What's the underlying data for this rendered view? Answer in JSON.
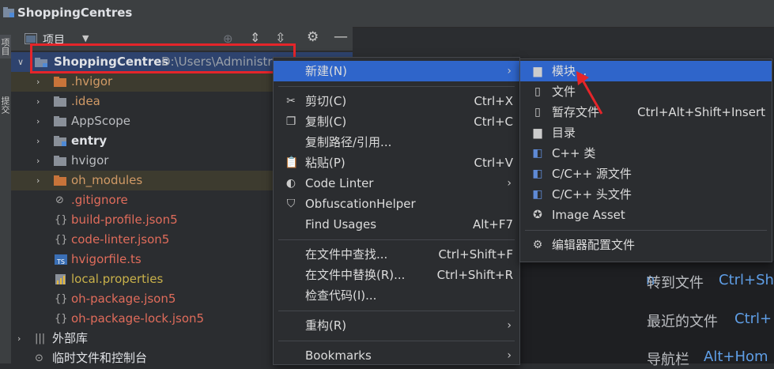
{
  "window": {
    "title": "ShoppingCentres"
  },
  "left_strip": {
    "tab1": "项目",
    "tab2": "提交"
  },
  "project_panel": {
    "view_label": "项目"
  },
  "tree": {
    "root_name": "ShoppingCentres",
    "root_path": "D:\\Users\\Administr",
    "items": [
      {
        "label": ".hvigor",
        "color": "#d19a66"
      },
      {
        "label": ".idea",
        "color": "#d19a66"
      },
      {
        "label": "AppScope",
        "color": "#bbbdc1"
      },
      {
        "label": "entry",
        "color": "#dfe1e5"
      },
      {
        "label": "hvigor",
        "color": "#bbbdc1"
      },
      {
        "label": "oh_modules",
        "color": "#d19a66"
      },
      {
        "label": ".gitignore",
        "color": "#e06c5b"
      },
      {
        "label": "build-profile.json5",
        "color": "#e06c5b"
      },
      {
        "label": "code-linter.json5",
        "color": "#e06c5b"
      },
      {
        "label": "hvigorfile.ts",
        "color": "#e06c5b"
      },
      {
        "label": "local.properties",
        "color": "#c9b14a"
      },
      {
        "label": "oh-package.json5",
        "color": "#e06c5b"
      },
      {
        "label": "oh-package-lock.json5",
        "color": "#e06c5b"
      }
    ],
    "external_libs": "外部库",
    "scratches": "临时文件和控制台"
  },
  "context_menu": {
    "new": "新建(N)",
    "cut": "剪切(C)",
    "cut_sc": "Ctrl+X",
    "copy": "复制(C)",
    "copy_sc": "Ctrl+C",
    "copy_path": "复制路径/引用...",
    "paste": "粘贴(P)",
    "paste_sc": "Ctrl+V",
    "code_linter": "Code Linter",
    "obfuscation": "ObfuscationHelper",
    "find_usages": "Find Usages",
    "find_usages_sc": "Alt+F7",
    "find_in_files": "在文件中查找...",
    "find_in_files_sc": "Ctrl+Shift+F",
    "replace_in_files": "在文件中替换(R)...",
    "replace_in_files_sc": "Ctrl+Shift+R",
    "inspect_code": "检查代码(I)...",
    "refactor": "重构(R)",
    "bookmarks": "Bookmarks"
  },
  "submenu": {
    "module": "模块...",
    "file": "文件",
    "scratch": "暂存文件",
    "scratch_sc": "Ctrl+Alt+Shift+Insert",
    "directory": "目录",
    "cpp_class": "C++ 类",
    "cpp_source": "C/C++ 源文件",
    "cpp_header": "C/C++ 头文件",
    "image_asset": "Image Asset",
    "editorconfig": "编辑器配置文件"
  },
  "editor_hints": {
    "goto_file": "转到文件",
    "goto_file_sc": "Ctrl+Sh",
    "recent": "最近的文件",
    "recent_sc": "Ctrl+",
    "navbar": "导航栏",
    "navbar_sc": "Alt+Hom"
  },
  "colors": {
    "accent": "#2f65ca",
    "annotation": "#e5252a"
  }
}
